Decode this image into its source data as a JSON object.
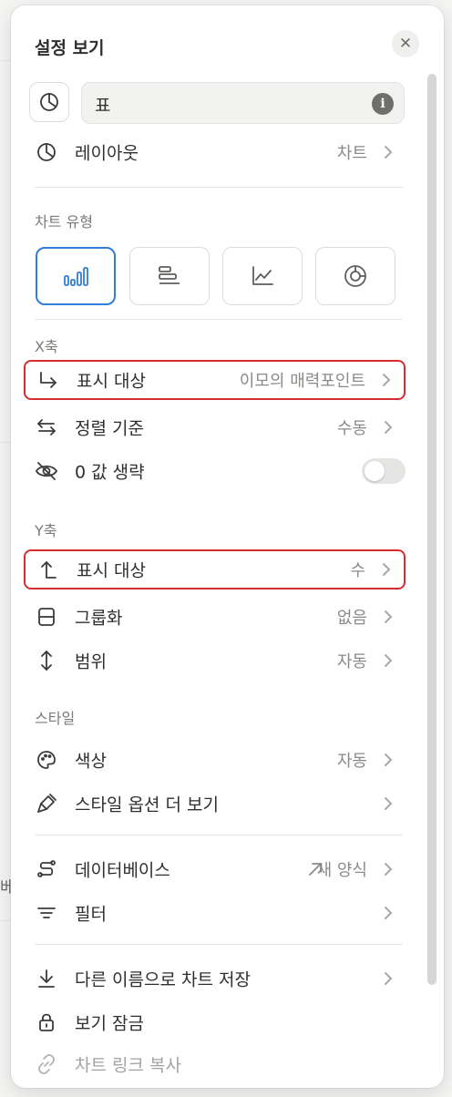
{
  "background": {
    "fragment_text": "베"
  },
  "header": {
    "title": "설정 보기",
    "close_icon": "close-icon"
  },
  "view_name": {
    "icon": "chart-pie-icon",
    "value": "표",
    "info_icon": "info-icon"
  },
  "layout_row": {
    "icon": "chart-pie-icon",
    "label": "레이아웃",
    "value": "차트"
  },
  "chart_type": {
    "section_label": "차트 유형",
    "options": [
      {
        "name": "vertical-bar",
        "icon": "vertical-bar-chart-icon",
        "selected": true
      },
      {
        "name": "horizontal-bar",
        "icon": "horizontal-bar-chart-icon",
        "selected": false
      },
      {
        "name": "line",
        "icon": "line-chart-icon",
        "selected": false
      },
      {
        "name": "donut",
        "icon": "donut-chart-icon",
        "selected": false
      }
    ],
    "accent_color": "#2f7ed8"
  },
  "x_axis": {
    "section_label": "X축",
    "show_label": "표시 대상",
    "show_value": "이모의 매력포인트",
    "sort_label": "정렬 기준",
    "sort_value": "수동",
    "omit_zero_label": "0 값 생략",
    "omit_zero_on": false
  },
  "y_axis": {
    "section_label": "Y축",
    "show_label": "표시 대상",
    "show_value": "수",
    "group_label": "그룹화",
    "group_value": "없음",
    "range_label": "범위",
    "range_value": "자동"
  },
  "style": {
    "section_label": "스타일",
    "color_label": "색상",
    "color_value": "자동",
    "more_label": "스타일 옵션 더 보기"
  },
  "data": {
    "database_label": "데이터베이스",
    "database_value": "새 양식",
    "filter_label": "필터"
  },
  "actions": {
    "save_as_label": "다른 이름으로 차트 저장",
    "lock_label": "보기 잠금",
    "copy_link_label": "차트 링크 복사"
  },
  "highlight_color": "#d92c2c"
}
